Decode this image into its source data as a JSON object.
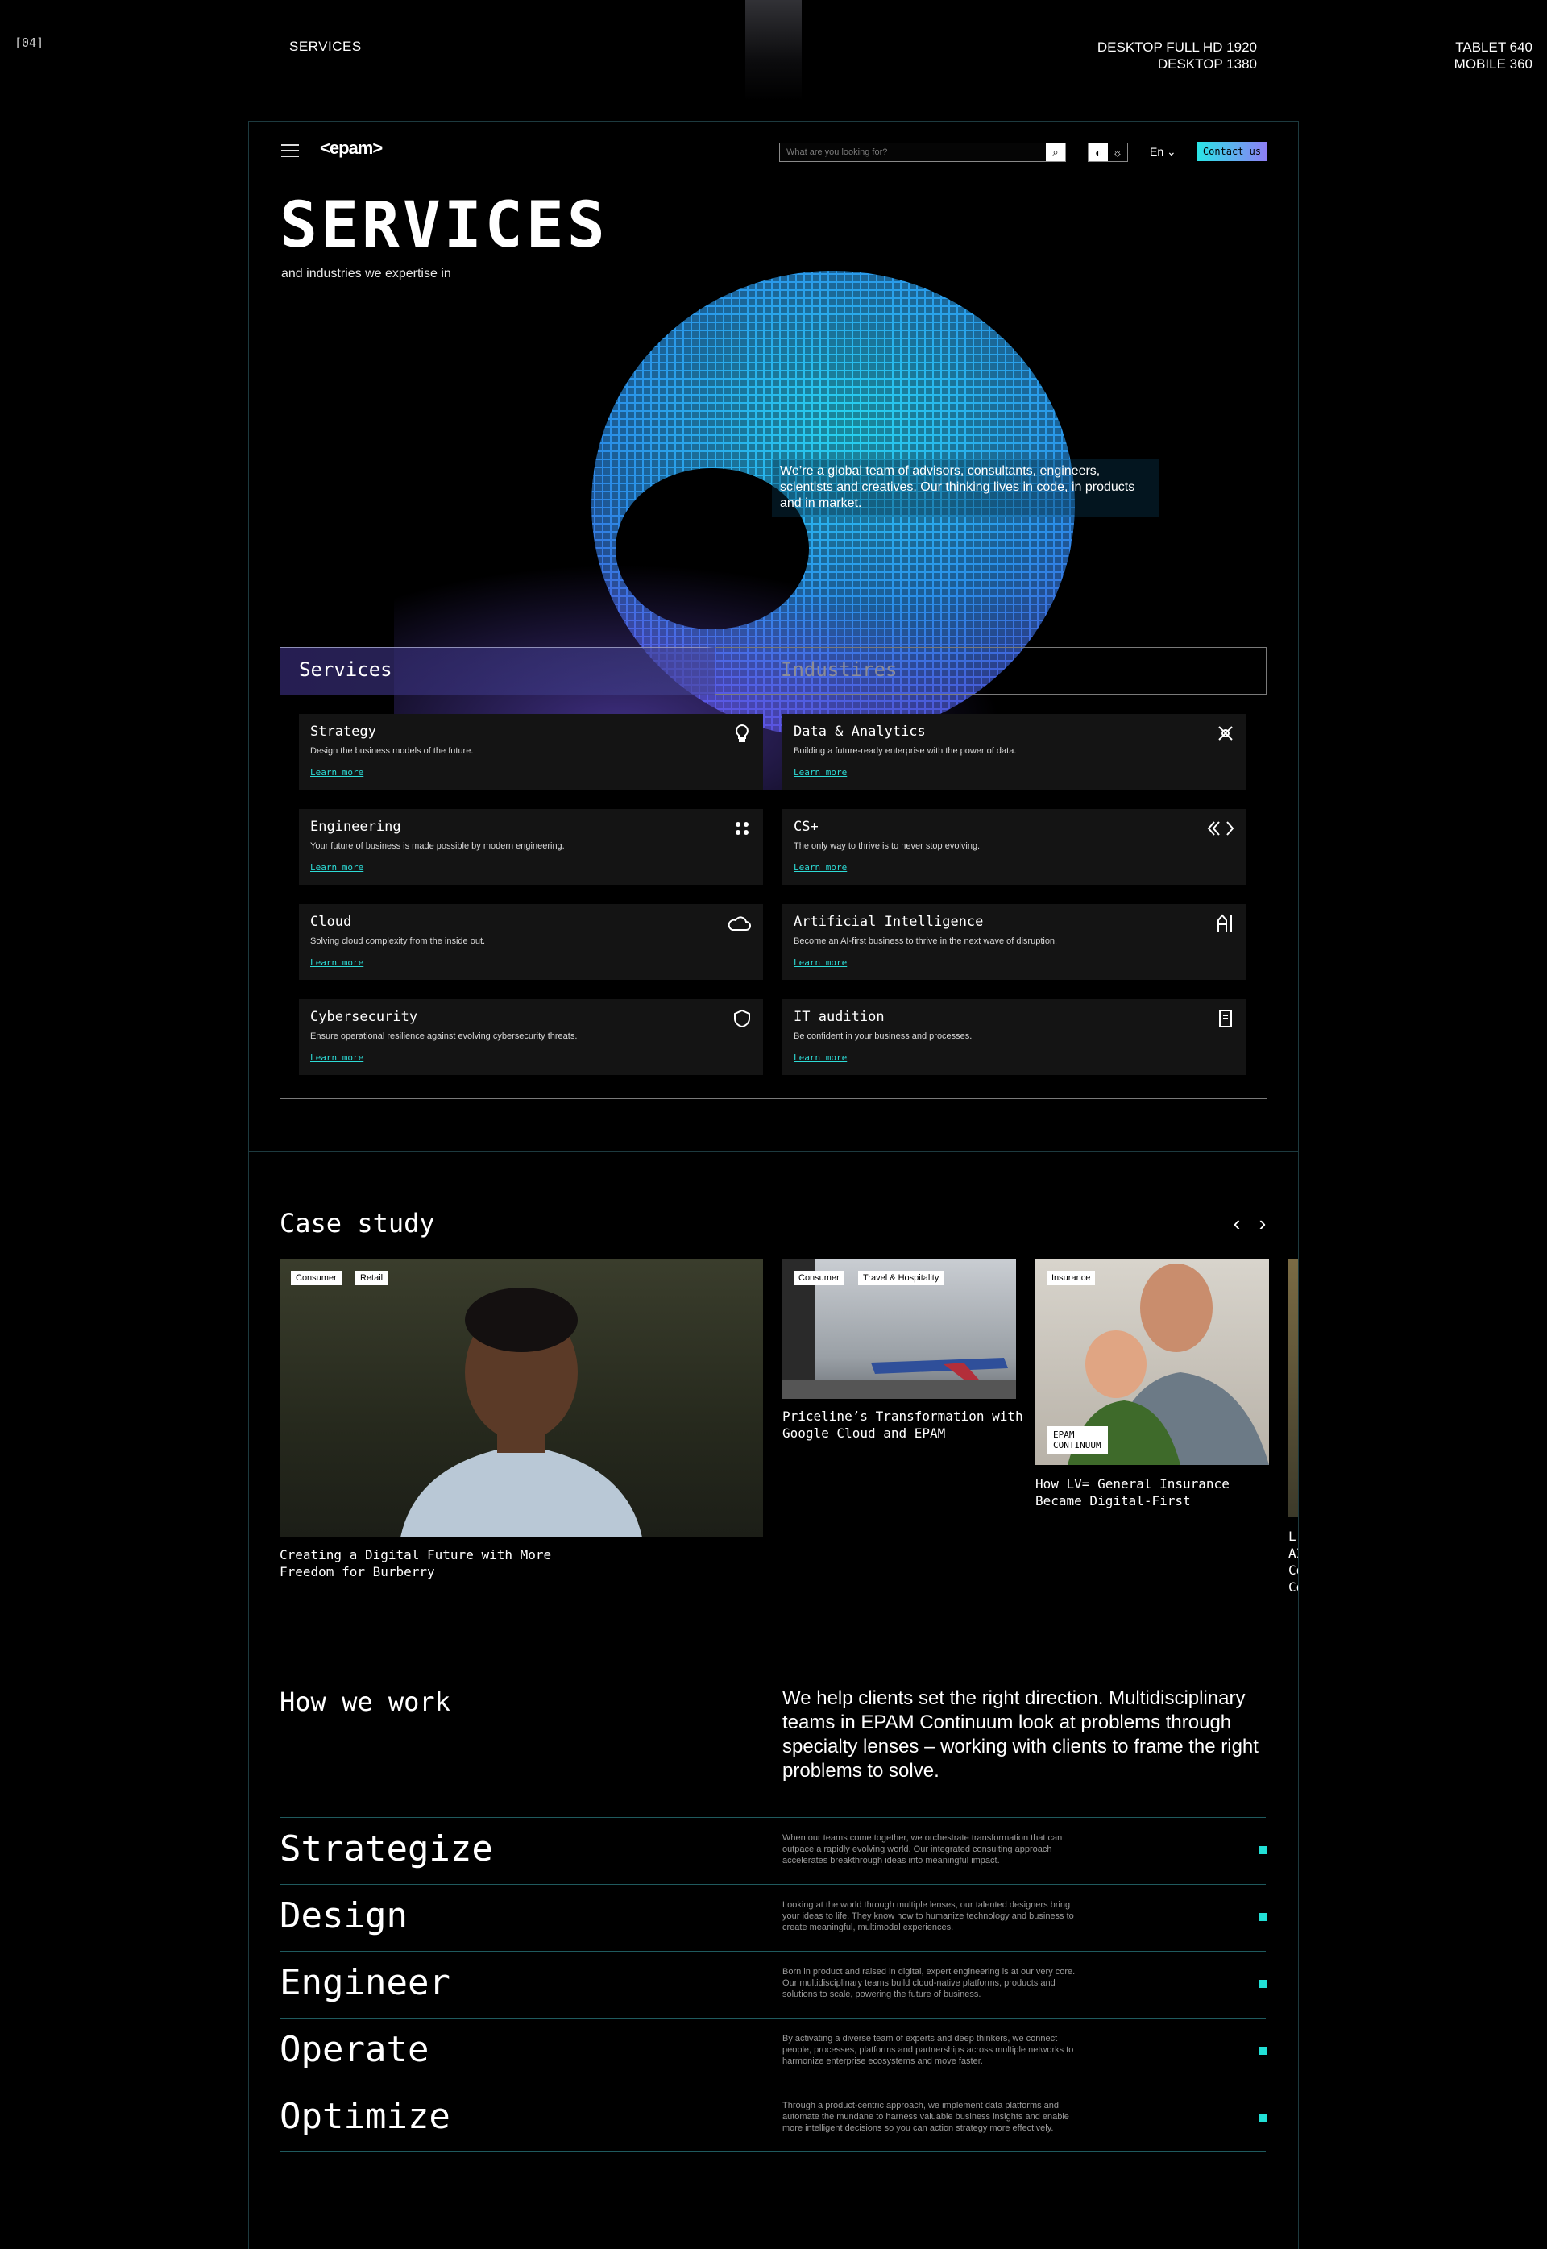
{
  "meta": {
    "frame_id": "[04]",
    "page_label": "SERVICES",
    "desktop_sizes": [
      "DESKTOP FULL HD 1920",
      "DESKTOP 1380"
    ],
    "mobile_sizes": [
      "TABLET 640",
      "MOBILE 360"
    ]
  },
  "header": {
    "logo": "<epam>",
    "search_placeholder": "What are you looking for?",
    "language": "En",
    "contact_label": "Contact us"
  },
  "hero": {
    "title": "SERVICES",
    "subtitle": "and industries we expertise in",
    "description": "We’re a global team of advisors, consultants, engineers, scientists and creatives. Our thinking lives in code, in products and in market."
  },
  "tabs": {
    "services": "Services",
    "industries": "Industires"
  },
  "services": [
    {
      "title": "Strategy",
      "desc": "Design the business models of the future.",
      "link": "Learn more",
      "icon": "lightbulb-icon"
    },
    {
      "title": "Data & Analytics",
      "desc": "Building a future-ready enterprise with the power of data.",
      "link": "Learn more",
      "icon": "network-icon"
    },
    {
      "title": "Engineering",
      "desc": "Your future of business is made possible by modern engineering.",
      "link": "Learn more",
      "icon": "gear-cluster-icon"
    },
    {
      "title": "CS+",
      "desc": "The only way to thrive is to never stop evolving.",
      "link": "Learn more",
      "icon": "code-brackets-icon"
    },
    {
      "title": "Cloud",
      "desc": "Solving cloud complexity from the inside out.",
      "link": "Learn more",
      "icon": "cloud-icon"
    },
    {
      "title": "Artificial Intelligence",
      "desc": "Become an AI-first business to thrive in the next wave of disruption.",
      "link": "Learn more",
      "icon": "ai-icon"
    },
    {
      "title": "Cybersecurity",
      "desc": "Ensure operational resilience against evolving cybersecurity threats.",
      "link": "Learn more",
      "icon": "shield-icon"
    },
    {
      "title": "IT audition",
      "desc": "Be confident in your business and processes.",
      "link": "Learn more",
      "icon": "clipboard-icon"
    }
  ],
  "case_study": {
    "title": "Case study",
    "items": [
      {
        "tags": [
          "Consumer",
          "Retail"
        ],
        "caption": "Creating a Digital Future with More Freedom for Burberry"
      },
      {
        "tags": [
          "Consumer",
          "Travel & Hospitality"
        ],
        "caption": "Priceline’s Transformation with Google Cloud and EPAM"
      },
      {
        "tags": [
          "Insurance"
        ],
        "caption": "How LV= General Insurance Became Digital-First",
        "badge": [
          "EPAM",
          "CONTINUUM"
        ]
      },
      {
        "tags": [],
        "caption": "L AI Co Co"
      }
    ]
  },
  "how_we_work": {
    "title": "How we work",
    "lead": "We help clients set the right direction. Multidisciplinary teams in EPAM Continuum look at problems through specialty lenses – working with clients to frame the right problems to solve.",
    "steps": [
      {
        "name": "Strategize",
        "desc": "When our teams come together, we orchestrate transformation that can outpace a rapidly evolving world. Our integrated consulting approach accelerates breakthrough ideas into meaningful impact."
      },
      {
        "name": "Design",
        "desc": "Looking at the world through multiple lenses, our talented designers bring your ideas to life. They know how to humanize technology and business to create meaningful, multimodal experiences."
      },
      {
        "name": "Engineer",
        "desc": "Born in product and raised in digital, expert engineering is at our very core. Our multidisciplinary teams build cloud-native platforms, products and solutions to scale, powering the future of business."
      },
      {
        "name": "Operate",
        "desc": "By activating a diverse team of experts and deep thinkers, we connect people, processes, platforms and partnerships across multiple networks to harmonize enterprise ecosystems and move faster."
      },
      {
        "name": "Optimize",
        "desc": "Through a product-centric approach, we implement data platforms and automate the mundane to harness valuable business insights and enable more intelligent decisions so you can action strategy more effectively."
      }
    ]
  },
  "colors": {
    "accent": "#22e0d6",
    "brand_gradient": [
      "#29e6e6",
      "#8f7df5"
    ],
    "frame_border": "#1d3a3f"
  }
}
